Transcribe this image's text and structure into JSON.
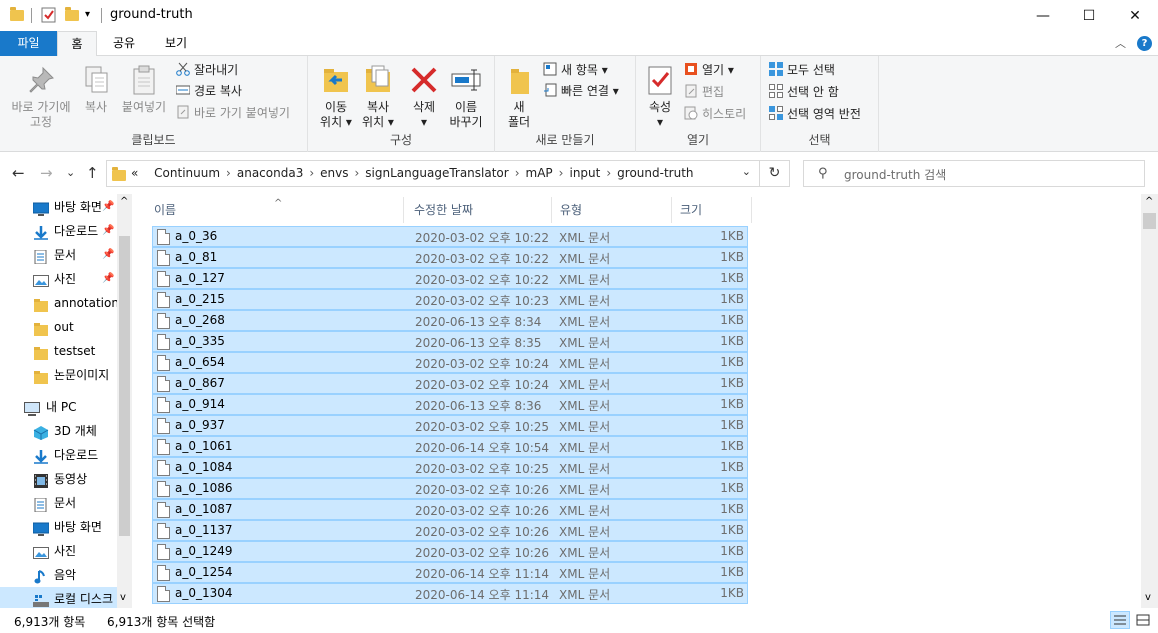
{
  "window": {
    "title": "ground-truth",
    "minimize": "—",
    "maximize": "☐",
    "close": "✕"
  },
  "menu": {
    "tabs": [
      "파일",
      "홈",
      "공유",
      "보기"
    ],
    "collapse_icon": "chevron-up-icon",
    "help": "?"
  },
  "ribbon": {
    "clipboard": {
      "label": "클립보드",
      "pin": [
        "바로 가기에",
        "고정"
      ],
      "copy": "복사",
      "paste": "붙여넣기",
      "cut": "잘라내기",
      "copy_path": "경로 복사",
      "paste_shortcut": "바로 가기 붙여넣기"
    },
    "organize": {
      "label": "구성",
      "move": [
        "이동",
        "위치 ▾"
      ],
      "copy_to": [
        "복사",
        "위치 ▾"
      ],
      "delete": [
        "삭제",
        "▾"
      ],
      "rename": [
        "이름",
        "바꾸기"
      ]
    },
    "new": {
      "label": "새로 만들기",
      "new_folder": [
        "새",
        "폴더"
      ],
      "new_item": "새 항목 ▾",
      "easy_access": "빠른 연결 ▾"
    },
    "open": {
      "label": "열기",
      "properties": [
        "속성",
        "▾"
      ],
      "open": "열기 ▾",
      "edit": "편집",
      "history": "히스토리"
    },
    "select": {
      "label": "선택",
      "select_all": "모두 선택",
      "select_none": "선택 안 함",
      "invert": "선택 영역 반전"
    },
    "accent_red": "#d62b2b",
    "accent_blue": "#1979ca"
  },
  "address": {
    "back": "←",
    "forward": "→",
    "recent": "⌄",
    "up": "↑",
    "prefix": "«",
    "crumbs": [
      "Continuum",
      "anaconda3",
      "envs",
      "signLanguageTranslator",
      "mAP",
      "input",
      "ground-truth"
    ],
    "separator": "›",
    "dropdown": "⌄",
    "refresh": "↻",
    "search_placeholder": "ground-truth 검색"
  },
  "navpane": {
    "quick": [
      {
        "label": "바탕 화면",
        "icon": "desktop-icon",
        "pinned": true
      },
      {
        "label": "다운로드",
        "icon": "download-icon",
        "pinned": true
      },
      {
        "label": "문서",
        "icon": "document-icon",
        "pinned": true
      },
      {
        "label": "사진",
        "icon": "pictures-icon",
        "pinned": true
      },
      {
        "label": "annotations",
        "icon": "folder-icon",
        "pinned": false
      },
      {
        "label": "out",
        "icon": "folder-icon",
        "pinned": false
      },
      {
        "label": "testset",
        "icon": "folder-icon",
        "pinned": false
      },
      {
        "label": "논문이미지",
        "icon": "folder-icon",
        "pinned": false
      }
    ],
    "pc_label": "내 PC",
    "pc_items": [
      {
        "label": "3D 개체",
        "icon": "3d-objects-icon"
      },
      {
        "label": "다운로드",
        "icon": "download-icon"
      },
      {
        "label": "동영상",
        "icon": "videos-icon"
      },
      {
        "label": "문서",
        "icon": "document-icon"
      },
      {
        "label": "바탕 화면",
        "icon": "desktop-icon"
      },
      {
        "label": "사진",
        "icon": "pictures-icon"
      },
      {
        "label": "음악",
        "icon": "music-icon"
      },
      {
        "label": "로컬 디스크",
        "icon": "local-disk-icon"
      }
    ],
    "scroll_up": "^",
    "scroll_down": "v"
  },
  "filelist": {
    "columns": [
      "이름",
      "수정한 날짜",
      "유형",
      "크기"
    ],
    "sort_indicator": "^",
    "rows": [
      {
        "name": "a_0_36",
        "date": "2020-03-02 오후 10:22",
        "type": "XML 문서",
        "size": "1KB"
      },
      {
        "name": "a_0_81",
        "date": "2020-03-02 오후 10:22",
        "type": "XML 문서",
        "size": "1KB"
      },
      {
        "name": "a_0_127",
        "date": "2020-03-02 오후 10:22",
        "type": "XML 문서",
        "size": "1KB"
      },
      {
        "name": "a_0_215",
        "date": "2020-03-02 오후 10:23",
        "type": "XML 문서",
        "size": "1KB"
      },
      {
        "name": "a_0_268",
        "date": "2020-06-13 오후 8:34",
        "type": "XML 문서",
        "size": "1KB"
      },
      {
        "name": "a_0_335",
        "date": "2020-06-13 오후 8:35",
        "type": "XML 문서",
        "size": "1KB"
      },
      {
        "name": "a_0_654",
        "date": "2020-03-02 오후 10:24",
        "type": "XML 문서",
        "size": "1KB"
      },
      {
        "name": "a_0_867",
        "date": "2020-03-02 오후 10:24",
        "type": "XML 문서",
        "size": "1KB"
      },
      {
        "name": "a_0_914",
        "date": "2020-06-13 오후 8:36",
        "type": "XML 문서",
        "size": "1KB"
      },
      {
        "name": "a_0_937",
        "date": "2020-03-02 오후 10:25",
        "type": "XML 문서",
        "size": "1KB"
      },
      {
        "name": "a_0_1061",
        "date": "2020-06-14 오후 10:54",
        "type": "XML 문서",
        "size": "1KB"
      },
      {
        "name": "a_0_1084",
        "date": "2020-03-02 오후 10:25",
        "type": "XML 문서",
        "size": "1KB"
      },
      {
        "name": "a_0_1086",
        "date": "2020-03-02 오후 10:26",
        "type": "XML 문서",
        "size": "1KB"
      },
      {
        "name": "a_0_1087",
        "date": "2020-03-02 오후 10:26",
        "type": "XML 문서",
        "size": "1KB"
      },
      {
        "name": "a_0_1137",
        "date": "2020-03-02 오후 10:26",
        "type": "XML 문서",
        "size": "1KB"
      },
      {
        "name": "a_0_1249",
        "date": "2020-03-02 오후 10:26",
        "type": "XML 문서",
        "size": "1KB"
      },
      {
        "name": "a_0_1254",
        "date": "2020-06-14 오후 11:14",
        "type": "XML 문서",
        "size": "1KB"
      },
      {
        "name": "a_0_1304",
        "date": "2020-06-14 오후 11:14",
        "type": "XML 문서",
        "size": "1KB"
      }
    ],
    "selection_color": "#cce8ff",
    "scroll_up": "^",
    "scroll_down": "v"
  },
  "status": {
    "count": "6,913개 항목",
    "selected": "6,913개 항목 선택함"
  }
}
